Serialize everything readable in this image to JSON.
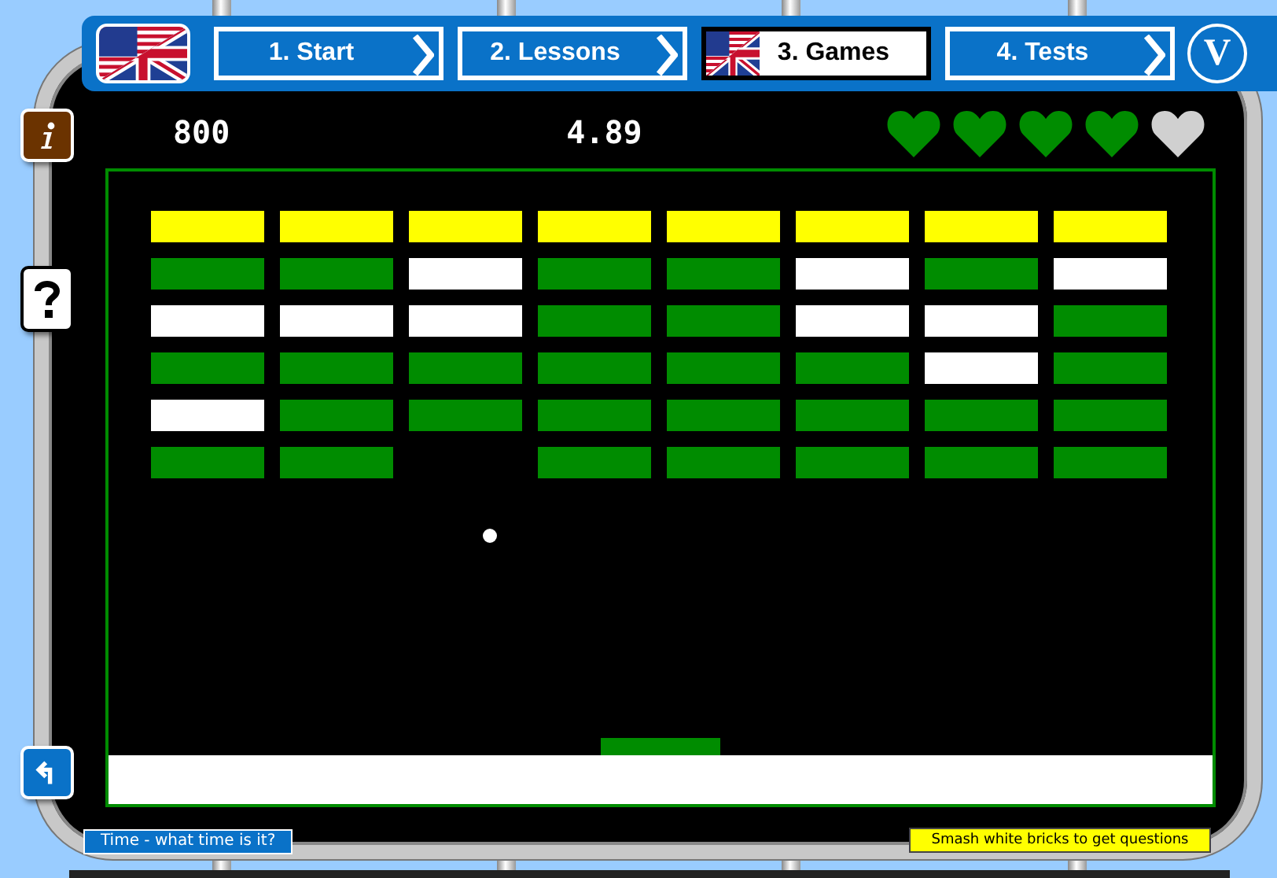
{
  "nav": {
    "tabs": [
      {
        "label": "1. Start",
        "selected": false
      },
      {
        "label": "2. Lessons",
        "selected": false
      },
      {
        "label": "3. Games",
        "selected": true
      },
      {
        "label": "4. Tests",
        "selected": false
      }
    ],
    "logo": "V"
  },
  "game": {
    "score": "800",
    "time": "4.89",
    "hearts": [
      {
        "filled": true
      },
      {
        "filled": true
      },
      {
        "filled": true
      },
      {
        "filled": true
      },
      {
        "filled": false
      }
    ],
    "bricks": [
      [
        {
          "color": "#ffff00"
        },
        {
          "color": "#ffff00"
        },
        {
          "color": "#ffff00"
        },
        {
          "color": "#ffff00"
        },
        {
          "color": "#ffff00"
        },
        {
          "color": "#ffff00"
        },
        {
          "color": "#ffff00"
        },
        {
          "color": "#ffff00"
        }
      ],
      [
        {
          "color": "#008c00"
        },
        {
          "color": "#008c00"
        },
        {
          "color": "#ffffff"
        },
        {
          "color": "#008c00"
        },
        {
          "color": "#008c00"
        },
        {
          "color": "#ffffff"
        },
        {
          "color": "#008c00"
        },
        {
          "color": "#ffffff"
        }
      ],
      [
        {
          "color": "#ffffff"
        },
        {
          "color": "#ffffff"
        },
        {
          "color": "#ffffff"
        },
        {
          "color": "#008c00"
        },
        {
          "color": "#008c00"
        },
        {
          "color": "#ffffff"
        },
        {
          "color": "#ffffff"
        },
        {
          "color": "#008c00"
        }
      ],
      [
        {
          "color": "#008c00"
        },
        {
          "color": "#008c00"
        },
        {
          "color": "#008c00"
        },
        {
          "color": "#008c00"
        },
        {
          "color": "#008c00"
        },
        {
          "color": "#008c00"
        },
        {
          "color": "#ffffff"
        },
        {
          "color": "#008c00"
        }
      ],
      [
        {
          "color": "#ffffff"
        },
        {
          "color": "#008c00"
        },
        {
          "color": "#008c00"
        },
        {
          "color": "#008c00"
        },
        {
          "color": "#008c00"
        },
        {
          "color": "#008c00"
        },
        {
          "color": "#008c00"
        },
        {
          "color": "#008c00"
        }
      ],
      [
        {
          "color": "#008c00"
        },
        {
          "color": "#008c00"
        },
        {
          "kind": "gap"
        },
        {
          "color": "#008c00"
        },
        {
          "color": "#008c00"
        },
        {
          "color": "#008c00"
        },
        {
          "color": "#008c00"
        },
        {
          "color": "#008c00"
        }
      ]
    ]
  },
  "footer": {
    "lesson": "Time - what time is it?",
    "hint": "Smash white bricks to get questions"
  }
}
